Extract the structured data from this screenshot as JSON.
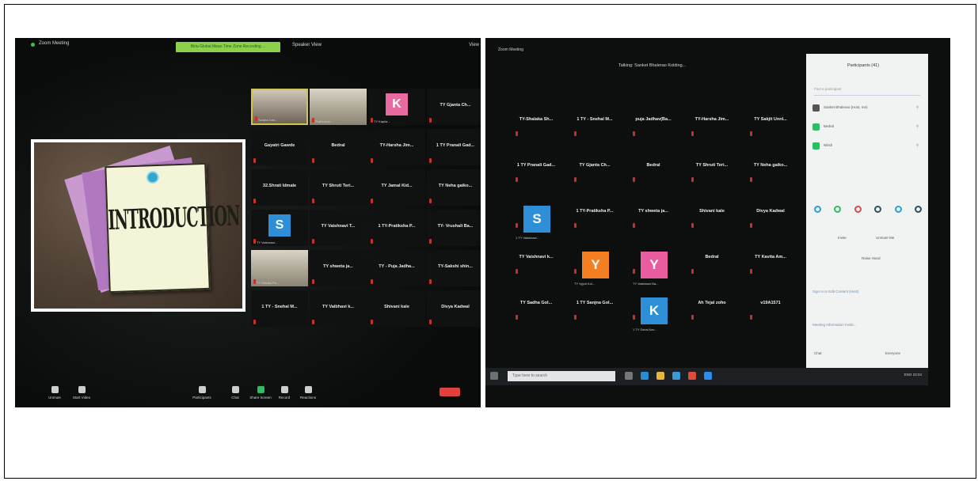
{
  "left_photo": {
    "app_title": "Zoom Meeting",
    "banner": "Birla Global Mean Time Zone Recording ...",
    "view_label": "Speaker View",
    "corner_label": "View",
    "shared_slide_text": "INTRODUCTION",
    "tiles": [
      {
        "name": "",
        "sub": "Sanjna Gan...",
        "style": "active"
      },
      {
        "name": "",
        "sub": "Prathmesh...",
        "style": "photo"
      },
      {
        "name": "",
        "sub": "TY Kapila...",
        "style": "avatar",
        "letter": "K",
        "color": "#e86a9e"
      },
      {
        "name": "TY Gjanta Ch..."
      },
      {
        "name": "Gayatri Gawde"
      },
      {
        "name": "Bedral"
      },
      {
        "name": "TY-Harsha Jim..."
      },
      {
        "name": "1 TY Pranali Gad..."
      },
      {
        "name": "32.Shrati Idmale"
      },
      {
        "name": "TY Shruti Teri..."
      },
      {
        "name": "TY Jamal Kid..."
      },
      {
        "name": "TY Neha gaiko..."
      },
      {
        "name": "",
        "sub": "TY Vaishnavi...",
        "style": "avatar",
        "letter": "S",
        "color": "#2e8fd6"
      },
      {
        "name": "TY Vaishnavi T..."
      },
      {
        "name": "1 TY-Pratiksha P..."
      },
      {
        "name": "TY- Vrushali Ba..."
      },
      {
        "name": "",
        "sub": "TY-Shivika Pa...",
        "style": "photo"
      },
      {
        "name": "TY shweta ja..."
      },
      {
        "name": "TY - Puja Jadha..."
      },
      {
        "name": "TY-Sakshi shin..."
      },
      {
        "name": "1 TY - Snehal M..."
      },
      {
        "name": "TY Vaibhavi k..."
      },
      {
        "name": "Shivani kale"
      },
      {
        "name": "Divya Kadwal"
      }
    ],
    "toolbar": [
      "Unmute",
      "Start Video",
      "Participants",
      "Chat",
      "Share Screen",
      "Record",
      "Reactions"
    ]
  },
  "right_photo": {
    "app_title": "Zoom Meeting",
    "speaking": "Talking: Sanket Bhalerao Kolding...",
    "tiles": [
      {
        "name": "TY-Shalaka Sh..."
      },
      {
        "name": "1 TY - Snehal M..."
      },
      {
        "name": "puja Jadhav(Ba..."
      },
      {
        "name": "TY-Harsha Jim..."
      },
      {
        "name": "TY Sakjit Unnl..."
      },
      {
        "name": "1 TY Pranali Gad..."
      },
      {
        "name": "TY Gjanta Ch..."
      },
      {
        "name": "Bedral"
      },
      {
        "name": "TY Shruti Teri..."
      },
      {
        "name": "TY Neha gaiko..."
      },
      {
        "name": "",
        "sub": "1 TY Vaishnavi...",
        "letter": "S",
        "color": "#2e8fd6"
      },
      {
        "name": "1 TY-Pratiksha P..."
      },
      {
        "name": "TY shweta ja..."
      },
      {
        "name": "Shivani kale"
      },
      {
        "name": "Divya Kadwal"
      },
      {
        "name": "TY Vaishnavi k..."
      },
      {
        "name": "",
        "sub": "TY Vyjuti Kol...",
        "letter": "Y",
        "color": "#f47e22"
      },
      {
        "name": "",
        "sub": "TY Vaishnavi Ba...",
        "letter": "Y",
        "color": "#e85d9f"
      },
      {
        "name": "Bedral"
      },
      {
        "name": "TY Kavita Am..."
      },
      {
        "name": "TY Sadha Gol..."
      },
      {
        "name": "1 TY Sanjna Gol..."
      },
      {
        "name": "",
        "sub": "1 TY Sonal Kar...",
        "letter": "K",
        "color": "#2e8fd6"
      },
      {
        "name": "Ah Tejal zoho"
      },
      {
        "name": "v19A1571"
      }
    ],
    "panel": {
      "title": "Participants (41)",
      "invite_placeholder": "Find a participant",
      "rows": [
        "Sanket Bhalerao (Host, me)",
        "Bedral",
        "Nitish"
      ],
      "buttons": [
        "Invite",
        "Unmute Me",
        "Raise Hand"
      ],
      "links": [
        "Sign In to Edit Content (Host)",
        "Meeting Information Invite..."
      ],
      "chat_label": "Chat",
      "chat_to": "Everyone"
    },
    "taskbar": {
      "search_placeholder": "Type here to search",
      "tray": "ENG 22:04"
    }
  }
}
